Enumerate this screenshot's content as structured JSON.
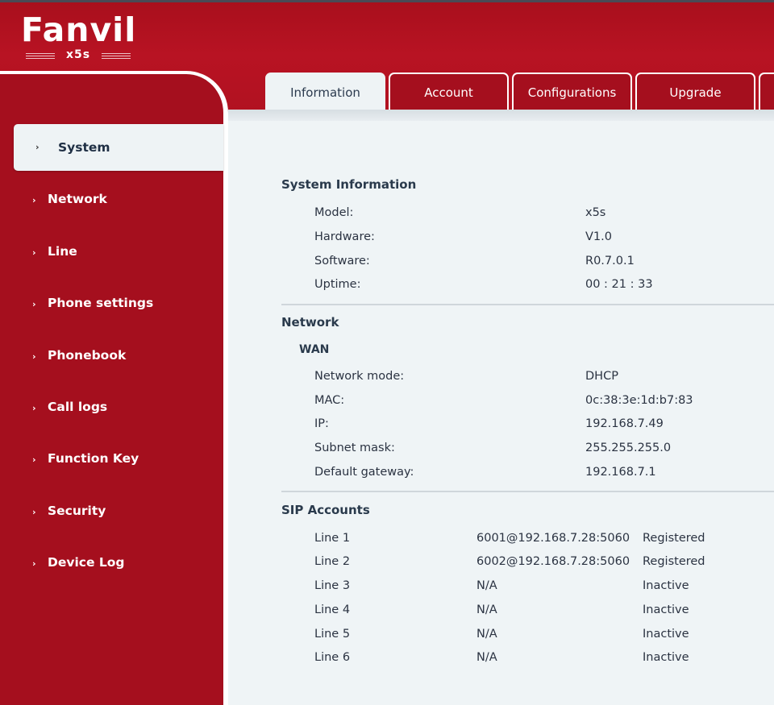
{
  "brand": {
    "logo_text": "Fanvil",
    "model": "x5s"
  },
  "tabs": [
    {
      "label": "Information",
      "active": true
    },
    {
      "label": "Account",
      "active": false
    },
    {
      "label": "Configurations",
      "active": false
    },
    {
      "label": "Upgrade",
      "active": false
    }
  ],
  "sidebar": {
    "items": [
      {
        "label": "System",
        "active": true
      },
      {
        "label": "Network"
      },
      {
        "label": "Line"
      },
      {
        "label": "Phone settings"
      },
      {
        "label": "Phonebook"
      },
      {
        "label": "Call logs"
      },
      {
        "label": "Function Key"
      },
      {
        "label": "Security"
      },
      {
        "label": "Device Log"
      }
    ]
  },
  "system_info": {
    "title": "System Information",
    "model_label": "Model:",
    "model": "x5s",
    "hardware_label": "Hardware:",
    "hardware": "V1.0",
    "software_label": "Software:",
    "software": "R0.7.0.1",
    "uptime_label": "Uptime:",
    "uptime": "00 : 21 : 33"
  },
  "network": {
    "title": "Network",
    "wan_title": "WAN",
    "mode_label": "Network mode:",
    "mode": "DHCP",
    "mac_label": "MAC:",
    "mac": "0c:38:3e:1d:b7:83",
    "ip_label": "IP:",
    "ip": "192.168.7.49",
    "mask_label": "Subnet mask:",
    "mask": "255.255.255.0",
    "gateway_label": "Default gateway:",
    "gateway": "192.168.7.1"
  },
  "sip": {
    "title": "SIP Accounts",
    "lines": [
      {
        "name": "Line 1",
        "account": "6001@192.168.7.28:5060",
        "status": "Registered"
      },
      {
        "name": "Line 2",
        "account": "6002@192.168.7.28:5060",
        "status": "Registered"
      },
      {
        "name": "Line 3",
        "account": "N/A",
        "status": "Inactive"
      },
      {
        "name": "Line 4",
        "account": "N/A",
        "status": "Inactive"
      },
      {
        "name": "Line 5",
        "account": "N/A",
        "status": "Inactive"
      },
      {
        "name": "Line 6",
        "account": "N/A",
        "status": "Inactive"
      }
    ]
  },
  "colors": {
    "brand_red": "#a50f1e",
    "panel_bg": "#eff4f6",
    "text_dark": "#2b3342"
  }
}
